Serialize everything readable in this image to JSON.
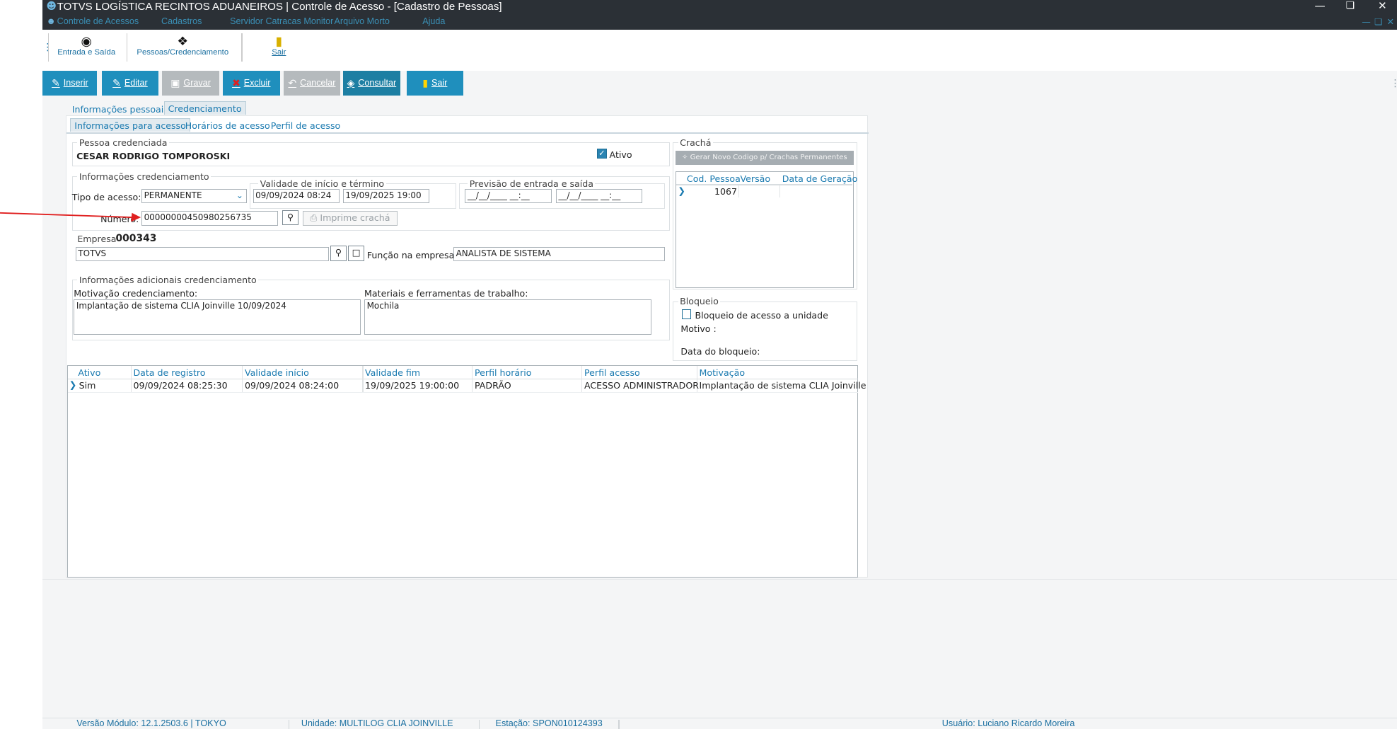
{
  "app": {
    "title": "TOTVS LOGÍSTICA RECINTOS ADUANEIROS | Controle de Acesso - [Cadastro de Pessoas]"
  },
  "menu": [
    "Controle de Acessos",
    "Cadastros",
    "Servidor Catracas Monitor",
    "Arquivo Morto",
    "Ajuda"
  ],
  "toolbar": [
    {
      "label": "Entrada e Saída",
      "icon": "traffic-light-icon"
    },
    {
      "label": "Pessoas/Credenciamento",
      "icon": "people-icon"
    },
    {
      "label": "Sair",
      "icon": "exit-door-icon"
    }
  ],
  "actions": {
    "inserir": "Inserir",
    "editar": "Editar",
    "gravar": "Gravar",
    "excluir": "Excluir",
    "cancelar": "Cancelar",
    "consultar": "Consultar",
    "sair": "Sair"
  },
  "tabs": {
    "main": [
      "Informações pessoais",
      "Credenciamento"
    ],
    "main_selected": "Credenciamento",
    "sub": [
      "Informações para acesso",
      "Horários de acesso",
      "Perfil de acesso"
    ],
    "sub_selected": "Informações para acesso"
  },
  "pessoa": {
    "group_label": "Pessoa credenciada",
    "nome": "CESAR RODRIGO TOMPOROSKI",
    "ativo_label": "Ativo",
    "ativo": true
  },
  "cred": {
    "group_label": "Informações credenciamento",
    "tipo_label": "Tipo de acesso:",
    "tipo_value": "PERMANENTE",
    "validade_label": "Validade de início e término",
    "validade_inicio": "09/09/2024 08:24",
    "validade_fim": "19/09/2025 19:00",
    "previsao_label": "Previsão de entrada e saída",
    "previsao_entrada": "__/__/____ __:__",
    "previsao_saida": "__/__/____ __:__",
    "numero_label": "Número:",
    "numero_value": "00000000450980256735",
    "imprime_label": "Imprime crachá"
  },
  "empresa": {
    "label": "Empresa",
    "codigo": "000343",
    "nome": "TOTVS",
    "funcao_label": "Função na empresa:",
    "funcao_value": "ANALISTA DE SISTEMA"
  },
  "adicionais": {
    "group_label": "Informações adicionais credenciamento",
    "motivacao_label": "Motivação credenciamento:",
    "motivacao_value": "Implantação de sistema CLIA Joinville 10/09/2024",
    "materiais_label": "Materiais e ferramentas de trabalho:",
    "materiais_value": "Mochila"
  },
  "cracha": {
    "group_label": "Crachá",
    "gerar_label": "Gerar Novo Codigo p/ Crachas Permanentes",
    "columns": [
      "Cod. Pessoa",
      "Versão",
      "Data de Geração"
    ],
    "rows": [
      [
        "1067",
        "",
        ""
      ]
    ]
  },
  "bloqueio": {
    "group_label": "Bloqueio",
    "chk_label": "Bloqueio de acesso a unidade",
    "checked": false,
    "motivo_label": "Motivo :",
    "data_label": "Data do bloqueio:"
  },
  "grid": {
    "columns": [
      "Ativo",
      "Data de registro",
      "Validade início",
      "Validade fim",
      "Perfil horário",
      "Perfil acesso",
      "Motivação"
    ],
    "rows": [
      [
        "Sim",
        "09/09/2024 08:25:30",
        "09/09/2024 08:24:00",
        "19/09/2025 19:00:00",
        "PADRÃO",
        "ACESSO ADMINISTRADOR",
        "Implantação de sistema CLIA Joinville"
      ]
    ]
  },
  "status": {
    "versao": "Versão Módulo:  12.1.2503.6  |  TOKYO",
    "unidade": "Unidade: MULTILOG CLIA JOINVILLE",
    "estacao": "Estação: SPON010124393",
    "usuario": "Usuário: Luciano Ricardo Moreira"
  },
  "colors": {
    "titlebar": "#2b3036",
    "accent": "#1f8fbd",
    "annotation_arrow": "#e02020"
  }
}
